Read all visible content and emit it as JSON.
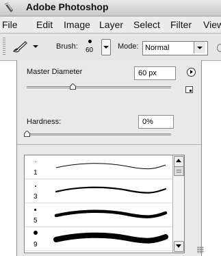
{
  "window": {
    "title": "Adobe Photoshop"
  },
  "menu": {
    "items": [
      "File",
      "Edit",
      "Image",
      "Layer",
      "Select",
      "Filter",
      "View"
    ]
  },
  "options_bar": {
    "tool_icon": "brush-icon",
    "brush_label": "Brush:",
    "brush_size": "60",
    "mode_label": "Mode:",
    "mode_value": "Normal"
  },
  "brush_panel": {
    "master_diameter_label": "Master Diameter",
    "master_diameter_value": "60 px",
    "master_diameter_level_fraction": 0.32,
    "hardness_label": "Hardness:",
    "hardness_value": "0%",
    "hardness_level_fraction": 0.0,
    "presets": [
      {
        "size": "1"
      },
      {
        "size": "3"
      },
      {
        "size": "5"
      },
      {
        "size": "9"
      }
    ]
  }
}
